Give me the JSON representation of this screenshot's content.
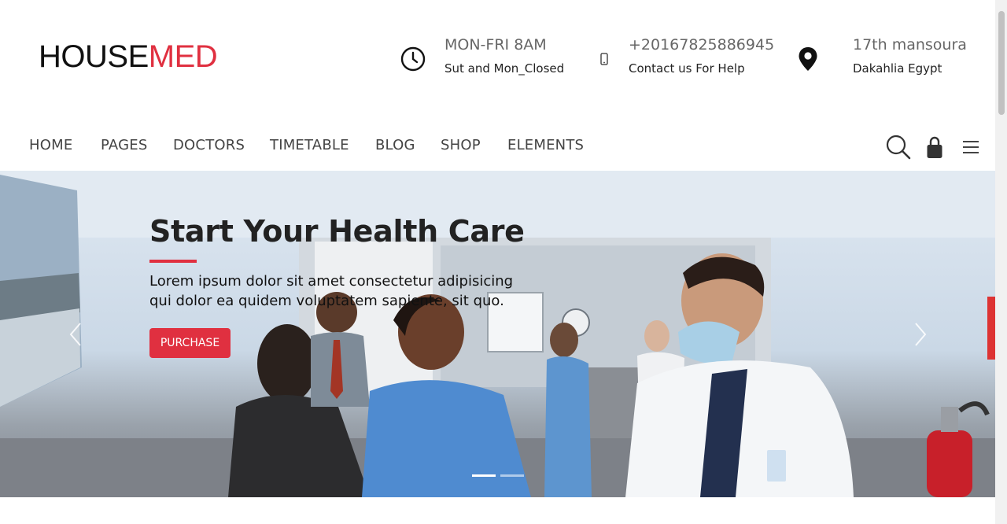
{
  "brand": {
    "part1": "HOUSE",
    "part2": "MED",
    "accent": "#e03040"
  },
  "contact": {
    "hours": {
      "line1": "MON-FRI 8AM",
      "line2": "Sut and Mon_Closed",
      "icon": "clock-icon"
    },
    "phone": {
      "line1": "+20167825886945",
      "line2": "Contact us For Help",
      "icon": "mobile-phone-icon"
    },
    "location": {
      "line1": "17th mansoura",
      "line2": "Dakahlia Egypt",
      "icon": "map-pin-icon"
    }
  },
  "nav": {
    "items": [
      {
        "label": "HOME"
      },
      {
        "label": "PAGES"
      },
      {
        "label": "DOCTORS"
      },
      {
        "label": "TIMETABLE"
      },
      {
        "label": "BLOG"
      },
      {
        "label": "SHOP"
      },
      {
        "label": "ELEMENTS"
      }
    ],
    "tools": [
      "search-icon",
      "lock-icon",
      "hamburger-menu-icon"
    ]
  },
  "hero": {
    "title": "Start Your Health Care",
    "text": "Lorem ipsum dolor sit amet consectetur adipisicing qui dolor ea quidem voluptatem sapiente, sit quo.",
    "button_label": "PURCHASE",
    "slides_total": 2,
    "active_slide": 1,
    "image": "hospital-staff-photo"
  }
}
